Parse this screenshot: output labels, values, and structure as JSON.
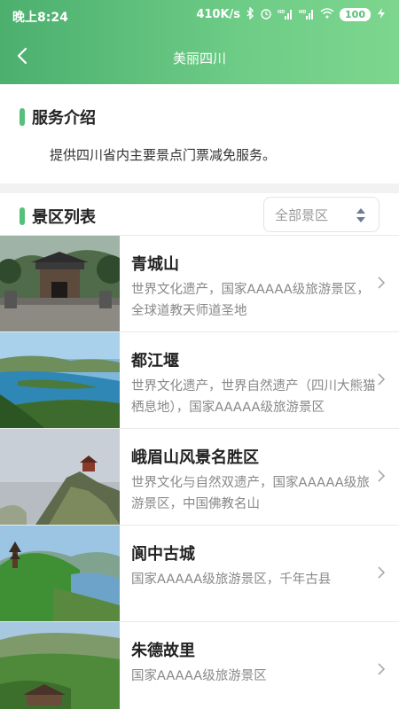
{
  "status": {
    "time": "晚上8:24",
    "speed": "410K/s",
    "battery": "100"
  },
  "nav": {
    "title": "美丽四川"
  },
  "service": {
    "title": "服务介绍",
    "text": "提供四川省内主要景点门票减免服务。"
  },
  "list": {
    "title": "景区列表",
    "filter_label": "全部景区",
    "items": [
      {
        "title": "青城山",
        "desc": "世界文化遗产，国家AAAAA级旅游景区，全球道教天师道圣地"
      },
      {
        "title": "都江堰",
        "desc": "世界文化遗产，世界自然遗产（四川大熊猫栖息地），国家AAAAA级旅游景区"
      },
      {
        "title": "峨眉山风景名胜区",
        "desc": "世界文化与自然双遗产，国家AAAAA级旅游景区，中国佛教名山"
      },
      {
        "title": "阆中古城",
        "desc": "国家AAAAA级旅游景区，千年古县"
      },
      {
        "title": "朱德故里",
        "desc": "国家AAAAA级旅游景区"
      }
    ]
  },
  "icons": {
    "back": "chevron-left-icon",
    "sort": "sort-updown-icon",
    "row_arrow": "chevron-right-icon"
  },
  "colors": {
    "accent": "#55c07a",
    "header_start": "#4caf6e",
    "header_end": "#7dd68e"
  }
}
